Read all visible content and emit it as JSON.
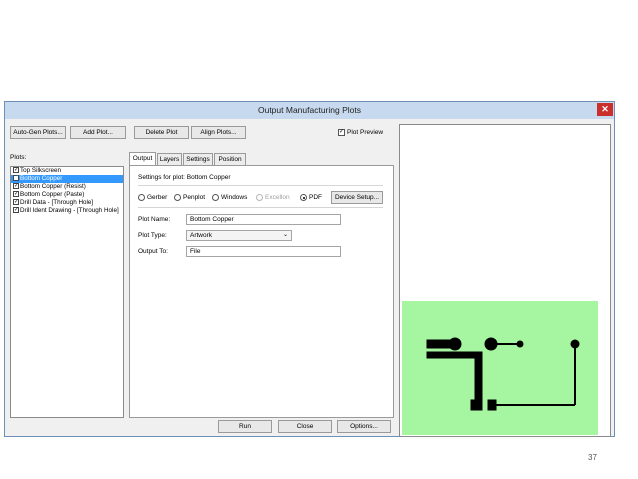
{
  "window": {
    "title": "Output Manufacturing Plots",
    "close_glyph": "✕"
  },
  "toolbar": {
    "autogen_label": "Auto-Gen Plots...",
    "add_label": "Add Plot...",
    "delete_label": "Delete Plot",
    "align_label": "Align Plots...",
    "preview_label": "Plot Preview",
    "preview_checked": true
  },
  "plots": {
    "label": "Plots:",
    "items": [
      {
        "label": "Top Silkscreen",
        "checked": true,
        "selected": false
      },
      {
        "label": "Bottom Copper",
        "checked": true,
        "selected": true
      },
      {
        "label": "Bottom Copper (Resist)",
        "checked": true,
        "selected": false
      },
      {
        "label": "Bottom Copper (Paste)",
        "checked": true,
        "selected": false
      },
      {
        "label": "Drill Data - [Through Hole]",
        "checked": true,
        "selected": false
      },
      {
        "label": "Drill Ident Drawing - [Through Hole]",
        "checked": true,
        "selected": false
      }
    ]
  },
  "tabs": [
    "Output",
    "Layers",
    "Settings",
    "Position"
  ],
  "output": {
    "settings_heading": "Settings for plot: Bottom Copper",
    "formats": [
      {
        "label": "Gerber",
        "selected": false,
        "disabled": false
      },
      {
        "label": "Penplot",
        "selected": false,
        "disabled": false
      },
      {
        "label": "Windows",
        "selected": false,
        "disabled": false
      },
      {
        "label": "Excellon",
        "selected": false,
        "disabled": true
      },
      {
        "label": "PDF",
        "selected": true,
        "disabled": false
      }
    ],
    "device_setup_label": "Device Setup...",
    "plot_name_label": "Plot Name:",
    "plot_name_value": "Bottom Copper",
    "plot_type_label": "Plot Type:",
    "plot_type_value": "Artwork",
    "output_to_label": "Output To:",
    "output_to_value": "File"
  },
  "footer": {
    "run_label": "Run",
    "close_label": "Close",
    "options_label": "Options..."
  },
  "colors": {
    "preview_board": "#a6f5a0",
    "trace": "#000000",
    "selection": "#3399ff",
    "title_bar": "#c7d9ee"
  },
  "page_number": "37"
}
